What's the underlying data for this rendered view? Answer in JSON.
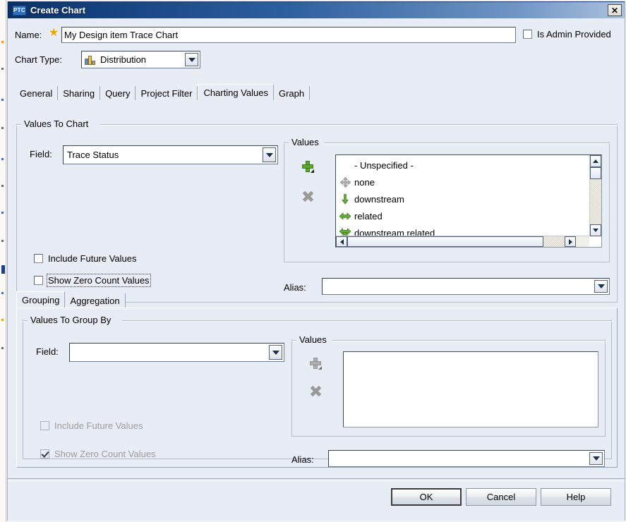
{
  "window": {
    "logo": "PTC",
    "title": "Create Chart",
    "close_icon": "close-icon",
    "close_glyph": "✕"
  },
  "form": {
    "name_label": "Name:",
    "name_required_marker": "★",
    "name_value": "My Design item Trace Chart",
    "name_placeholder": "",
    "is_admin_provided_label": "Is Admin Provided",
    "is_admin_provided_checked": false,
    "chart_type_label": "Chart Type:",
    "chart_type_value": "Distribution",
    "chart_type_icon": "bar-chart-icon"
  },
  "tabs": [
    {
      "label": "General",
      "active": false
    },
    {
      "label": "Sharing",
      "active": false
    },
    {
      "label": "Query",
      "active": false
    },
    {
      "label": "Project Filter",
      "active": false
    },
    {
      "label": "Charting Values",
      "active": true
    },
    {
      "label": "Graph",
      "active": false
    }
  ],
  "values_to_chart": {
    "group_title": "Values To Chart",
    "field_label": "Field:",
    "field_value": "Trace Status",
    "include_future_label": "Include Future Values",
    "include_future_checked": false,
    "include_future_disabled": false,
    "show_zero_label": "Show Zero Count Values",
    "show_zero_checked": false,
    "show_zero_disabled": false,
    "show_zero_focused": true,
    "values_group_title": "Values",
    "add_icon": "add-plus-icon",
    "remove_icon": "remove-x-icon",
    "add_disabled": false,
    "remove_disabled": false,
    "items": [
      {
        "label": "- Unspecified -",
        "icon": "none-icon"
      },
      {
        "label": "none",
        "icon": "four-way-arrow-icon"
      },
      {
        "label": "downstream",
        "icon": "down-arrow-icon"
      },
      {
        "label": "related",
        "icon": "left-right-arrow-icon"
      },
      {
        "label": "downstream related",
        "icon": "down-and-left-right-arrow-icon"
      }
    ],
    "alias_label": "Alias:",
    "alias_value": "",
    "scrollbar_vertical": "vertical-scrollbar",
    "scrollbar_horizontal": "horizontal-scrollbar"
  },
  "lower_tabs": [
    {
      "label": "Grouping",
      "active": true
    },
    {
      "label": "Aggregation",
      "active": false
    }
  ],
  "values_to_group_by": {
    "group_title": "Values To Group By",
    "field_label": "Field:",
    "field_value": "",
    "include_future_label": "Include Future Values",
    "include_future_checked": false,
    "include_future_disabled": true,
    "show_zero_label": "Show Zero Count Values",
    "show_zero_checked": true,
    "show_zero_disabled": true,
    "values_group_title": "Values",
    "add_icon": "add-plus-icon",
    "remove_icon": "remove-x-icon",
    "add_disabled": true,
    "remove_disabled": true,
    "items": [],
    "alias_label": "Alias:",
    "alias_value": ""
  },
  "buttons": {
    "ok": "OK",
    "cancel": "Cancel",
    "help": "Help"
  },
  "colors": {
    "title_bar_dark": "#0b2f63",
    "title_bar_light": "#a9c1dd",
    "dialog_bg": "#e8edf5",
    "accent_green": "#5aa832",
    "required_star": "#f0a500"
  }
}
